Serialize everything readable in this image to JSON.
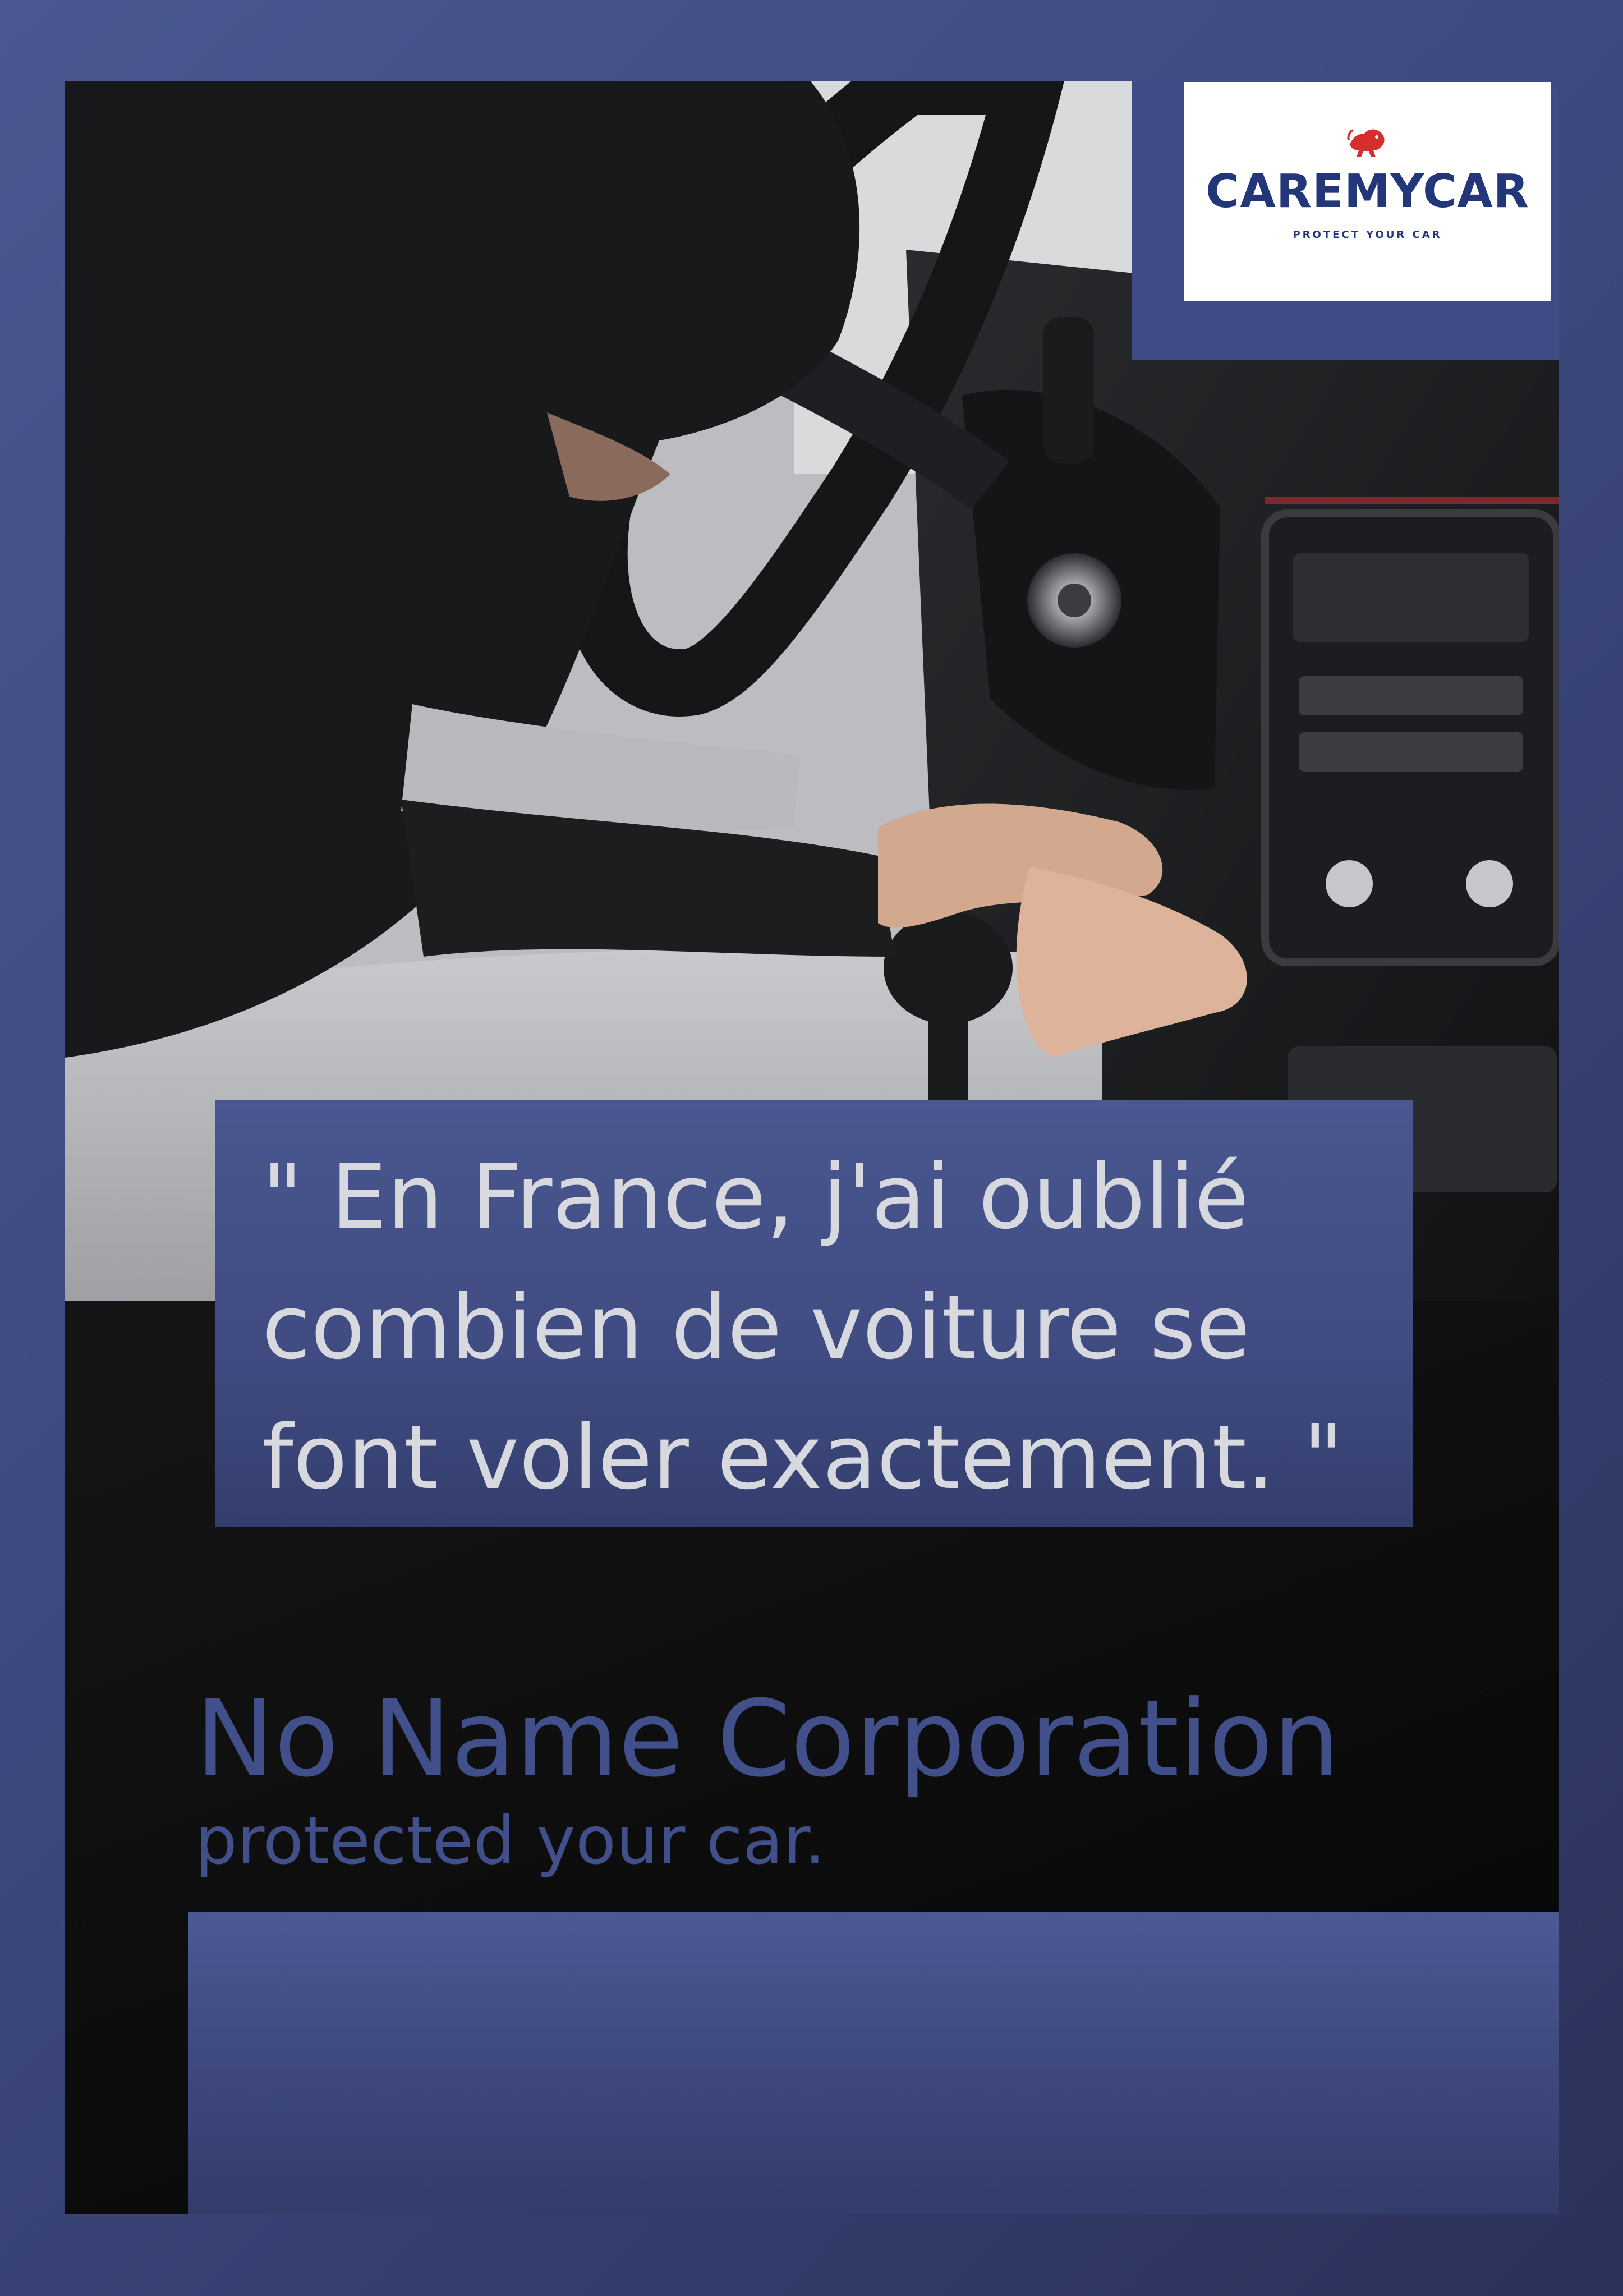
{
  "colors": {
    "background": "#3e4a80",
    "frame": "#131314",
    "accent_blue": "#414f8a",
    "quote_text": "#d8d9df",
    "logo_navy": "#22377a",
    "logo_red": "#d62e2e"
  },
  "logo": {
    "icon": "lion-icon",
    "name": "CAREMYCAR",
    "tagline": "PROTECT YOUR CAR"
  },
  "photo": {
    "subject": "car-theft-photo"
  },
  "quote": {
    "line1": "\" En France, j'ai oublié",
    "line2": "combien de voiture se",
    "line3": "font voler exactement. \""
  },
  "company": {
    "name": "No Name Corporation",
    "tagline": "protected your car."
  }
}
